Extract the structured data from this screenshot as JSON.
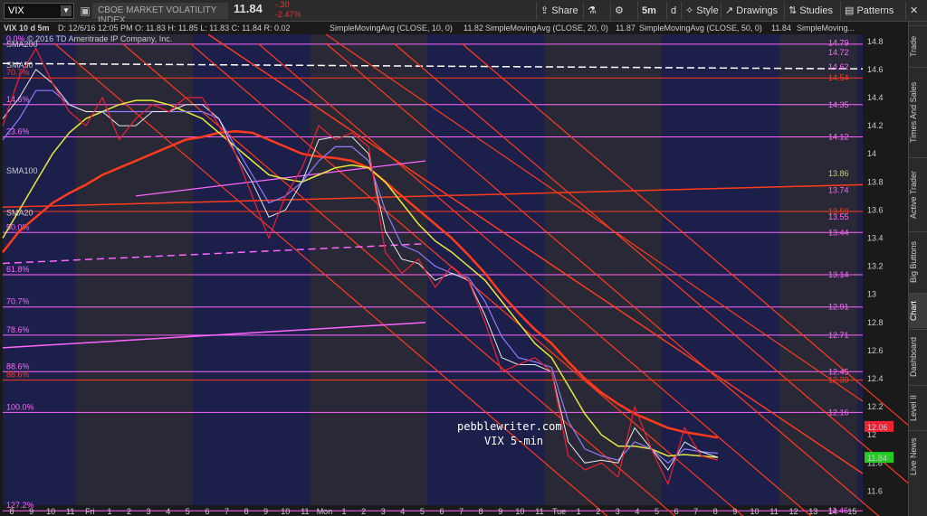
{
  "toolbar": {
    "symbol": "VIX",
    "name": "CBOE MARKET VOLATILITY INDEX",
    "last": "11.84",
    "change": "-.30",
    "change_pct": "-2.47%",
    "share": "Share",
    "interval": "5m",
    "style": "Style",
    "drawings": "Drawings",
    "studies": "Studies",
    "patterns": "Patterns"
  },
  "header": {
    "title": "VIX 10 d 5m",
    "ohlc": "D: 12/6/16 12:05 PM   O: 11.83   H: 11.85   L: 11.83   C: 11.84   R: 0.02",
    "sma10": "SimpleMovingAvg (CLOSE, 10, 0)",
    "sma10_val": "11.82",
    "sma20": "SimpleMovingAvg (CLOSE, 20, 0)",
    "sma20_val": "11.87",
    "sma50": "SimpleMovingAvg (CLOSE, 50, 0)",
    "sma50_val": "11.84",
    "sma200": "SimpleMoving...",
    "copyright": "© 2016 TD Ameritrade IP Company, Inc."
  },
  "side_tabs": [
    "Trade",
    "Times And Sales",
    "Active Trader",
    "Big Buttons",
    "Chart",
    "Dashboard",
    "Level II",
    "Live News"
  ],
  "watermark": {
    "line1": "pebblewriter.com",
    "line2": "VIX 5-min"
  },
  "colors": {
    "bg": "#1b1f4a",
    "band": "#2a2a33",
    "sma10": "#e8e8e8",
    "sma20": "#8c7cff",
    "sma50": "#e8e83a",
    "sma200": "#ff3b1c",
    "fib": "#ff66ff",
    "channel": "#ff3b1c"
  },
  "chart_data": {
    "type": "line",
    "price_tick_labels": [
      "14.8",
      "14.6",
      "14.4",
      "14.2",
      "14",
      "13.8",
      "13.6",
      "13.4",
      "13.2",
      "13",
      "12.8",
      "12.6",
      "12.4",
      "12.2",
      "12",
      "11.8",
      "11.6"
    ],
    "ylim": [
      11.5,
      14.85
    ],
    "x_labels": [
      "8",
      "9",
      "10",
      "11",
      "Fri",
      "1",
      "2",
      "3",
      "4",
      "5",
      "6",
      "7",
      "8",
      "9",
      "10",
      "11",
      "Mon",
      "1",
      "2",
      "3",
      "4",
      "5",
      "6",
      "7",
      "8",
      "9",
      "10",
      "11",
      "Tue",
      "1",
      "2",
      "3",
      "4",
      "5",
      "6",
      "7",
      "8",
      "9",
      "10",
      "11",
      "12",
      "13",
      "14",
      "15"
    ],
    "fib_levels": [
      {
        "label": "0.0%",
        "value": 14.78
      },
      {
        "label": "14.6%",
        "value": 14.35
      },
      {
        "label": "23.6%",
        "value": 14.12
      },
      {
        "label": "50.0%",
        "value": 13.44
      },
      {
        "label": "61.8%",
        "value": 13.14
      },
      {
        "label": "70.7%",
        "value": 12.91
      },
      {
        "label": "78.6%",
        "value": 12.71
      },
      {
        "label": "88.6%",
        "value": 12.45
      },
      {
        "label": "100.0%",
        "value": 12.16
      },
      {
        "label": "127.2%",
        "value": 11.46
      }
    ],
    "red_levels": [
      {
        "label": "70.7%",
        "value": 14.54
      },
      {
        "label": "88.6%",
        "value": 12.39
      },
      {
        "label": "",
        "value": 13.59
      }
    ],
    "right_labels": [
      {
        "text": "14.79",
        "value": 14.79,
        "color": "#ff66ff"
      },
      {
        "text": "14.72",
        "value": 14.72,
        "color": "#ff66ff"
      },
      {
        "text": "14.62",
        "value": 14.62,
        "color": "#ff66ff"
      },
      {
        "text": "14.54",
        "value": 14.54,
        "color": "#ff3b1c"
      },
      {
        "text": "14.35",
        "value": 14.35,
        "color": "#ff66ff"
      },
      {
        "text": "14.12",
        "value": 14.12,
        "color": "#ff66ff"
      },
      {
        "text": "13.86",
        "value": 13.86,
        "color": "#cccc66"
      },
      {
        "text": "13.74",
        "value": 13.74,
        "color": "#ff66ff"
      },
      {
        "text": "13.59",
        "value": 13.59,
        "color": "#ff3b1c"
      },
      {
        "text": "13.55",
        "value": 13.55,
        "color": "#ff66ff"
      },
      {
        "text": "13.44",
        "value": 13.44,
        "color": "#ff66ff"
      },
      {
        "text": "13.14",
        "value": 13.14,
        "color": "#ff66ff"
      },
      {
        "text": "12.91",
        "value": 12.91,
        "color": "#ff66ff"
      },
      {
        "text": "12.71",
        "value": 12.71,
        "color": "#ff66ff"
      },
      {
        "text": "12.45",
        "value": 12.45,
        "color": "#ff66ff"
      },
      {
        "text": "12.39",
        "value": 12.39,
        "color": "#ff3b1c"
      },
      {
        "text": "12.16",
        "value": 12.16,
        "color": "#ff66ff"
      },
      {
        "text": "11.46",
        "value": 11.46,
        "color": "#ff66ff"
      }
    ],
    "ma_labels": [
      {
        "text": "SMA200",
        "value": 14.78
      },
      {
        "text": "SMA50",
        "value": 14.63
      },
      {
        "text": "SMA100",
        "value": 13.88
      },
      {
        "text": "SMA20",
        "value": 13.58
      }
    ],
    "last_price": {
      "value": 11.84,
      "text": "11.84"
    },
    "prev_price": {
      "value": 12.06,
      "text": "12.06"
    },
    "price_path": [
      14.2,
      14.55,
      14.75,
      14.5,
      14.3,
      14.2,
      14.4,
      14.1,
      14.25,
      14.35,
      14.3,
      14.4,
      14.4,
      14.2,
      14.0,
      13.7,
      13.4,
      13.7,
      13.9,
      14.2,
      14.1,
      14.15,
      14.05,
      13.3,
      13.15,
      13.25,
      13.05,
      13.2,
      13.1,
      12.8,
      12.45,
      12.5,
      12.55,
      12.45,
      11.85,
      11.75,
      11.8,
      11.7,
      12.2,
      11.9,
      11.65,
      12.05,
      11.85,
      11.82
    ],
    "sma10": [
      14.25,
      14.4,
      14.6,
      14.5,
      14.35,
      14.3,
      14.3,
      14.2,
      14.2,
      14.3,
      14.3,
      14.35,
      14.35,
      14.25,
      14.0,
      13.8,
      13.55,
      13.6,
      13.8,
      14.1,
      14.12,
      14.12,
      14.0,
      13.45,
      13.25,
      13.22,
      13.1,
      13.15,
      13.1,
      12.85,
      12.55,
      12.5,
      12.5,
      12.45,
      11.95,
      11.8,
      11.82,
      11.8,
      12.05,
      11.9,
      11.75,
      11.95,
      11.88,
      11.84
    ],
    "sma20": [
      14.1,
      14.25,
      14.45,
      14.45,
      14.35,
      14.3,
      14.3,
      14.3,
      14.3,
      14.3,
      14.3,
      14.3,
      14.3,
      14.25,
      14.05,
      13.85,
      13.65,
      13.7,
      13.8,
      13.95,
      14.05,
      14.05,
      13.95,
      13.6,
      13.35,
      13.3,
      13.2,
      13.15,
      13.12,
      12.95,
      12.7,
      12.55,
      12.52,
      12.48,
      12.1,
      11.9,
      11.85,
      11.82,
      11.95,
      11.9,
      11.8,
      11.9,
      11.88,
      11.87
    ],
    "sma50": [
      13.4,
      13.6,
      13.8,
      14.0,
      14.15,
      14.25,
      14.3,
      14.35,
      14.38,
      14.38,
      14.35,
      14.3,
      14.25,
      14.15,
      14.05,
      13.95,
      13.85,
      13.82,
      13.8,
      13.85,
      13.9,
      13.92,
      13.9,
      13.8,
      13.65,
      13.5,
      13.38,
      13.3,
      13.2,
      13.1,
      12.95,
      12.8,
      12.65,
      12.55,
      12.35,
      12.15,
      12.0,
      11.92,
      11.92,
      11.9,
      11.85,
      11.86,
      11.85,
      11.84
    ],
    "sma200": [
      13.3,
      13.45,
      13.55,
      13.65,
      13.72,
      13.78,
      13.85,
      13.9,
      13.95,
      14.0,
      14.05,
      14.1,
      14.12,
      14.15,
      14.16,
      14.15,
      14.1,
      14.05,
      14.0,
      13.98,
      13.97,
      13.95,
      13.9,
      13.8,
      13.7,
      13.6,
      13.5,
      13.4,
      13.28,
      13.15,
      13.0,
      12.87,
      12.75,
      12.65,
      12.52,
      12.4,
      12.3,
      12.22,
      12.15,
      12.1,
      12.05,
      12.02,
      12.0,
      11.98
    ]
  }
}
